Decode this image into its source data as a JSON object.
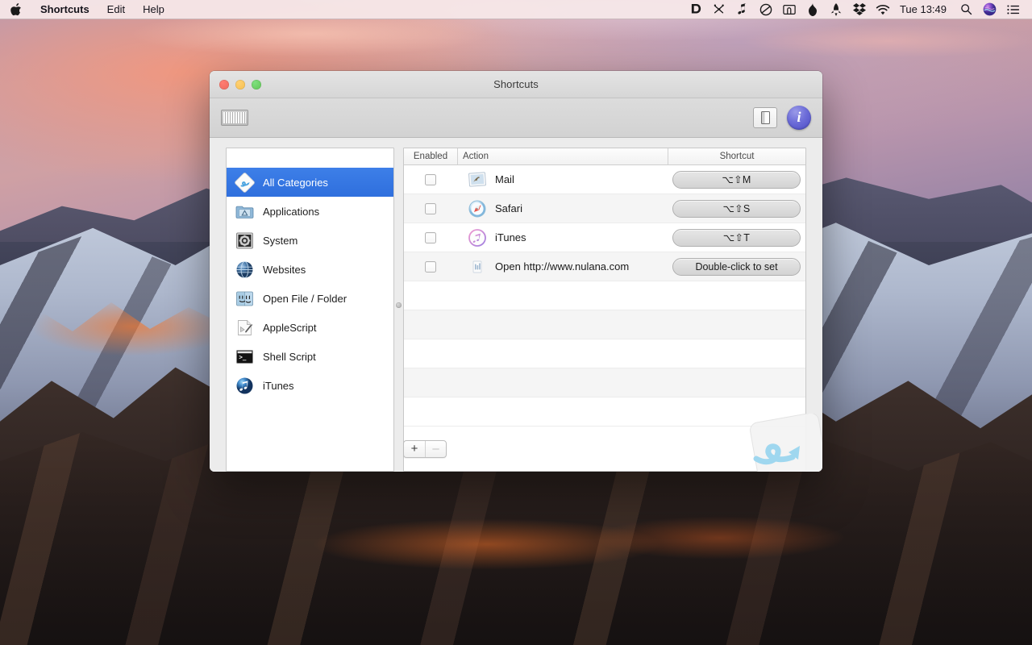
{
  "menubar": {
    "apple_icon": "apple-logo-icon",
    "items": [
      {
        "label": "Shortcuts",
        "bold": true
      },
      {
        "label": "Edit",
        "bold": false
      },
      {
        "label": "Help",
        "bold": false
      }
    ],
    "status_icons": [
      "devonthink-icon",
      "shortcuts-scissors-icon",
      "music-note-icon",
      "do-not-disturb-icon",
      "screenshot-frame-icon",
      "flame-icon",
      "rocket-icon",
      "dropbox-icon",
      "wifi-icon"
    ],
    "clock": "Tue 13:49",
    "spotlight_icon": "search-icon",
    "siri_icon": "siri-icon",
    "notification_icon": "notification-center-icon"
  },
  "window": {
    "title": "Shortcuts",
    "traffic_lights": {
      "close": "close-button",
      "minimize": "minimize-button",
      "zoom": "zoom-button"
    },
    "toolbar": {
      "keyboard_button": "keyboard-icon",
      "sidebar_toggle": "sidebar-toggle-button",
      "info_button_label": "i"
    },
    "footer": {
      "add_label": "+",
      "remove_label": "–"
    }
  },
  "sidebar": {
    "items": [
      {
        "label": "All Categories",
        "icon": "shortcuts-app-icon",
        "selected": true
      },
      {
        "label": "Applications",
        "icon": "applications-folder-icon",
        "selected": false
      },
      {
        "label": "System",
        "icon": "system-preferences-icon",
        "selected": false
      },
      {
        "label": "Websites",
        "icon": "globe-icon",
        "selected": false
      },
      {
        "label": "Open File / Folder",
        "icon": "finder-icon",
        "selected": false
      },
      {
        "label": "AppleScript",
        "icon": "applescript-editor-icon",
        "selected": false
      },
      {
        "label": "Shell Script",
        "icon": "terminal-icon",
        "selected": false
      },
      {
        "label": "iTunes",
        "icon": "itunes-icon",
        "selected": false
      }
    ]
  },
  "table": {
    "headers": {
      "enabled": "Enabled",
      "action": "Action",
      "shortcut": "Shortcut"
    },
    "rows": [
      {
        "enabled": false,
        "icon": "mail-icon",
        "action": "Mail",
        "shortcut": "⌥⇧M"
      },
      {
        "enabled": false,
        "icon": "safari-icon",
        "action": "Safari",
        "shortcut": "⌥⇧S"
      },
      {
        "enabled": false,
        "icon": "itunes-icon",
        "action": "iTunes",
        "shortcut": "⌥⇧T"
      },
      {
        "enabled": false,
        "icon": "webloc-icon",
        "action": "Open http://www.nulana.com",
        "shortcut": "Double-click to set"
      }
    ],
    "empty_row_count": 5
  },
  "colors": {
    "selection_blue": "#2f6fdd",
    "info_button_purple": "#5a5ad0",
    "menubar_bg": "#f6e8e9",
    "row_stripe": "#f5f5f5"
  }
}
